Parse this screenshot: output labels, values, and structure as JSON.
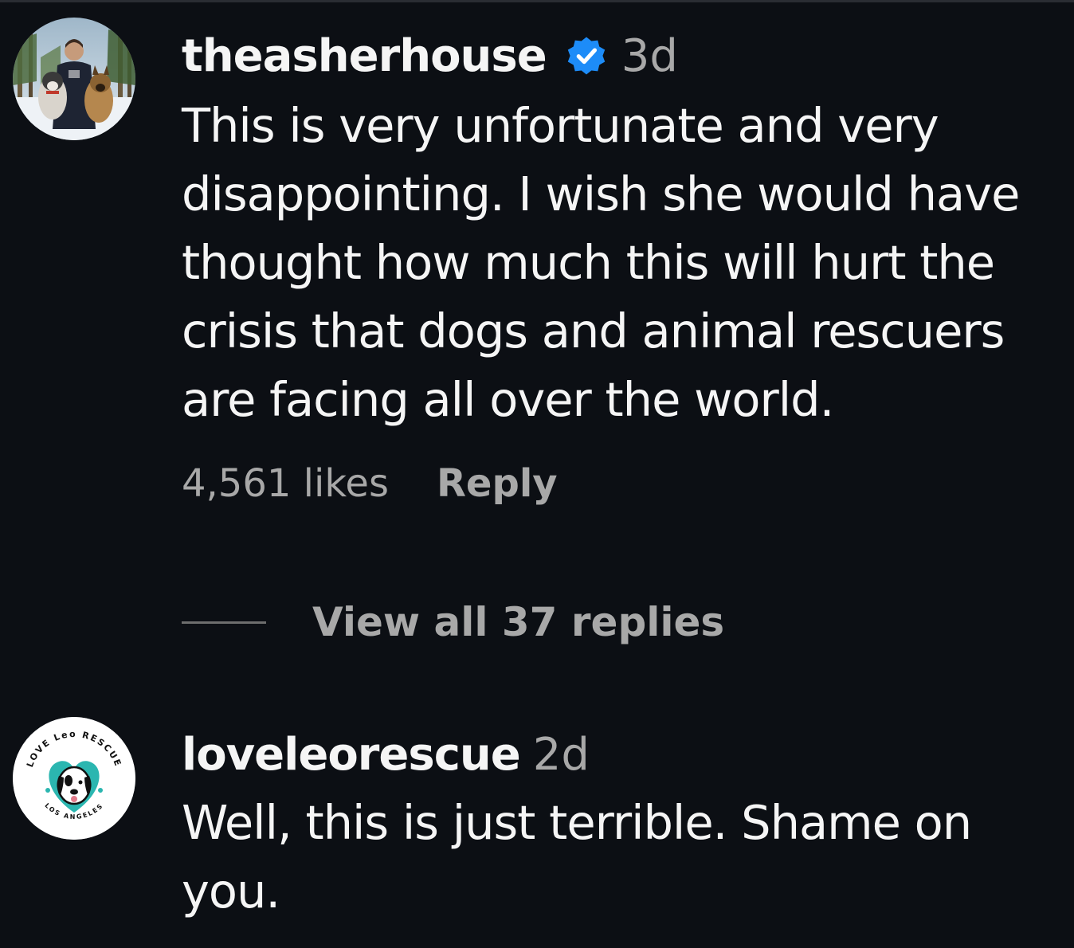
{
  "comments": [
    {
      "username": "theasherhouse",
      "verified": true,
      "time": "3d",
      "text_lines": [
        "This is very unfortunate and very",
        "disappointing. I wish she would have",
        "thought how much this will hurt the",
        "crisis that dogs and animal rescuers",
        "are facing all over the world."
      ],
      "likes": "4,561 likes",
      "reply_label": "Reply",
      "view_replies_label": "View all 37 replies",
      "avatar_icon": "man-with-dogs-photo"
    },
    {
      "username": "loveleorescue",
      "verified": false,
      "time": "2d",
      "text_lines": [
        "Well, this is just terrible. Shame on",
        "you."
      ],
      "avatar_icon": "love-leo-rescue-logo",
      "avatar_logo_text": {
        "top": "LOVE Leo RESCUE",
        "bottom": "LOS ANGELES"
      }
    }
  ],
  "colors": {
    "background": "#0c0f14",
    "primary_text": "#f5f5f5",
    "secondary_text": "#a8a8a8",
    "verified_badge": "#1d8cf8",
    "logo_teal": "#2bb6b0"
  }
}
